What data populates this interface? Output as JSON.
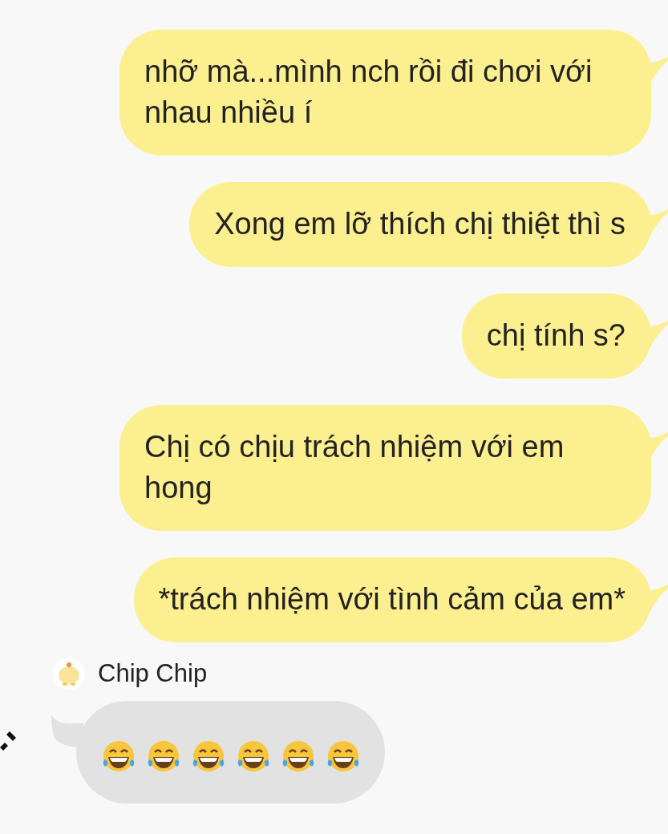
{
  "messages": [
    {
      "kind": "sent",
      "text": "nhỡ mà...mình nch rồi đi chơi với nhau nhiều í"
    },
    {
      "kind": "sent",
      "text": "Xong em lỡ thích chị thiệt thì s"
    },
    {
      "kind": "sent",
      "text": "chị tính s?"
    },
    {
      "kind": "sent",
      "text": "Chị có chịu trách nhiệm với em hong"
    },
    {
      "kind": "sent",
      "text": "*trách nhiệm với tình cảm của em*"
    }
  ],
  "incoming": {
    "sender": "Chip Chip",
    "emojis": [
      {
        "kind": "tears-of-joy"
      },
      {
        "kind": "tears-of-joy"
      },
      {
        "kind": "tears-of-joy"
      },
      {
        "kind": "tears-of-joy"
      },
      {
        "kind": "tears-of-joy"
      },
      {
        "kind": "tears-of-joy"
      }
    ]
  }
}
